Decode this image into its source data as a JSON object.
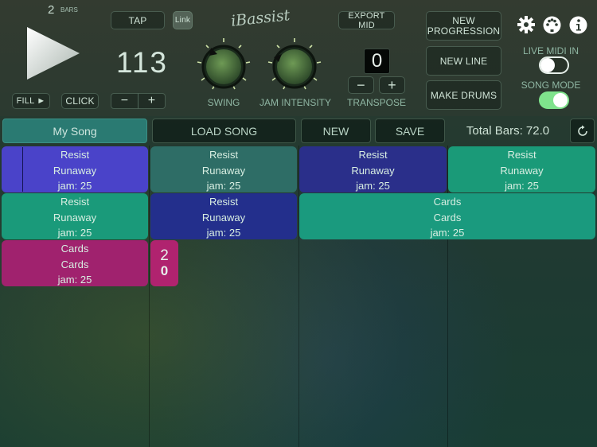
{
  "transport": {
    "bars_count": "2",
    "bars_label": "BARS",
    "fill_label": "FILL ►",
    "click_label": "CLICK"
  },
  "tempo": {
    "tap_label": "TAP",
    "link_label": "Link",
    "bpm": "113",
    "minus": "−",
    "plus": "+"
  },
  "logo": "iBassist",
  "knobs": {
    "swing_label": "SWING",
    "jam_label": "JAM INTENSITY"
  },
  "transpose": {
    "export_label": "EXPORT MID",
    "value": "0",
    "minus": "−",
    "plus": "+",
    "label": "TRANSPOSE"
  },
  "actions": {
    "new_progression": "NEW PROGRESSION",
    "new_line": "NEW LINE",
    "make_drums": "MAKE DRUMS"
  },
  "toggles": {
    "live_midi_label": "LIVE MIDI IN",
    "live_midi_on": false,
    "song_mode_label": "SONG MODE",
    "song_mode_on": true
  },
  "icons": [
    "gear-icon",
    "midi-icon",
    "info-icon"
  ],
  "song_bar": {
    "song_name": "My Song",
    "load_label": "LOAD SONG",
    "new_label": "NEW",
    "save_label": "SAVE",
    "total_bars": "Total Bars: 72.0"
  },
  "clips": [
    {
      "line1": "Resist",
      "line2": "Runaway",
      "line3": "jam: 25",
      "color": "#4a43c9"
    },
    {
      "line1": "Resist",
      "line2": "Runaway",
      "line3": "jam: 25",
      "color": "#2e6d66"
    },
    {
      "line1": "Resist",
      "line2": "Runaway",
      "line3": "jam: 25",
      "color": "#2a2f8a"
    },
    {
      "line1": "Resist",
      "line2": "Runaway",
      "line3": "jam: 25",
      "color": "#1a9a78"
    },
    {
      "line1": "Resist",
      "line2": "Runaway",
      "line3": "jam: 25",
      "color": "#1a9a7a"
    },
    {
      "line1": "Resist",
      "line2": "Runaway",
      "line3": "jam: 25",
      "color": "#232f8c"
    },
    {
      "line1": "Cards",
      "line2": "Cards",
      "line3": "jam: 25",
      "color": "#1a9a7e"
    },
    {
      "line1": "Cards",
      "line2": "Cards",
      "line3": "jam: 25",
      "color": "#a0226e"
    }
  ],
  "marker": {
    "top": "2",
    "bottom": "0",
    "color": "#b0236f"
  }
}
